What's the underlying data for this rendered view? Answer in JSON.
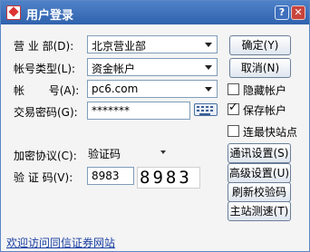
{
  "window": {
    "title": "用户登录",
    "help_glyph": "?",
    "close_glyph": "✕"
  },
  "form": {
    "department_label": "营 业 部(D):",
    "department_value": "北京营业部",
    "account_type_label": "帐号类型(L):",
    "account_type_value": "资金帐户",
    "account_label": "帐       号(A):",
    "account_value": "pc6.com",
    "password_label": "交易密码(G):",
    "password_value": "*******",
    "encrypt_label": "加密协议(C):",
    "encrypt_value": "验证码",
    "captcha_label": "验 证 码(V):",
    "captcha_input_value": "8983",
    "captcha_image_text": "8983"
  },
  "buttons": {
    "confirm": "确定(Y)",
    "cancel": "取消(N)",
    "comm_settings": "通讯设置(S)",
    "advanced_settings": "高级设置(U)",
    "refresh_captcha": "刷新校验码",
    "site_speed_test": "主站测速(T)"
  },
  "checkboxes": {
    "hide_account": {
      "label": "隐藏帐户",
      "checked": false
    },
    "save_account": {
      "label": "保存帐户",
      "checked": true
    },
    "fastest_site": {
      "label": "连最快站点",
      "checked": false
    }
  },
  "footer": {
    "link_text": "欢迎访问同信证券网站"
  },
  "colors": {
    "titlebar": "#3b6fbb",
    "link": "#1b3fa3",
    "close": "#c8443a"
  }
}
